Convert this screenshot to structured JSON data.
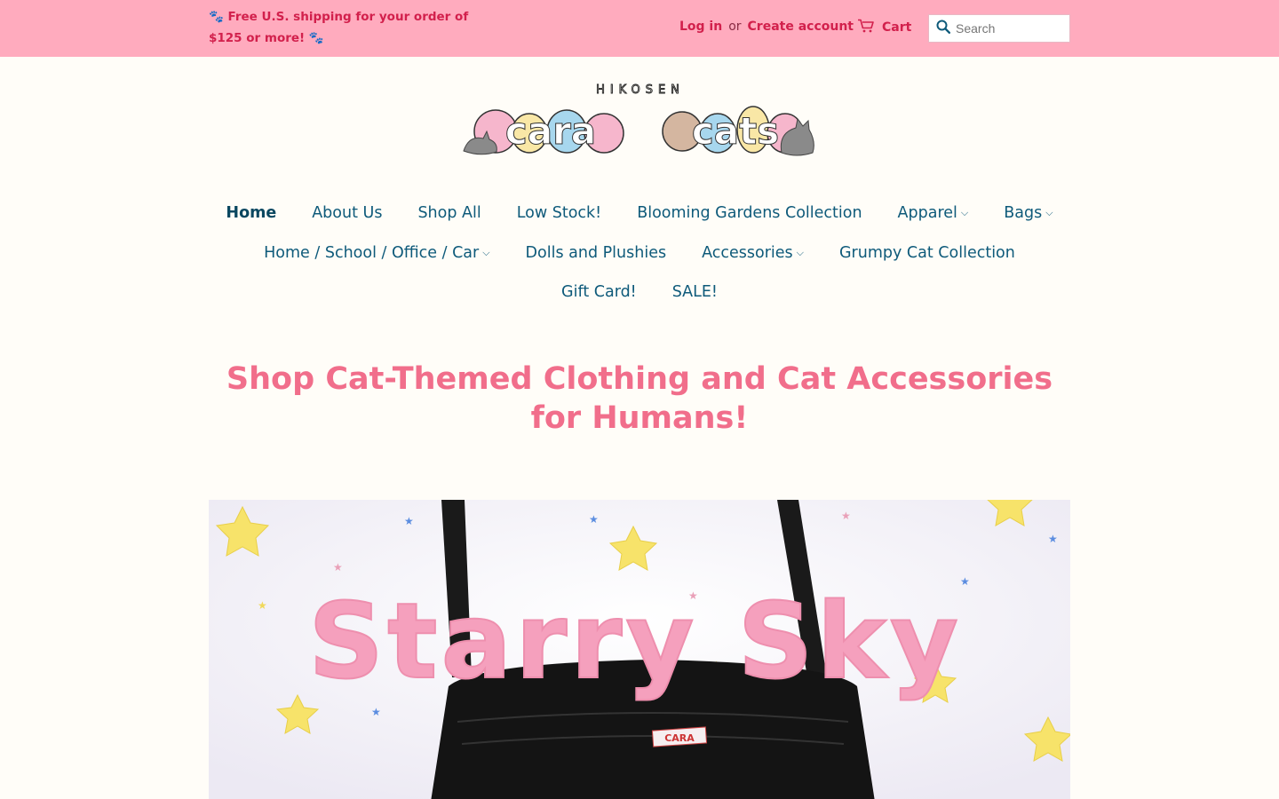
{
  "announcement": {
    "text": "🐾 Free U.S. shipping for your order of $125 or more! 🐾"
  },
  "account": {
    "login_label": "Log in",
    "or_label": "or",
    "create_label": "Create account"
  },
  "cart": {
    "label": "Cart"
  },
  "search": {
    "placeholder": "Search"
  },
  "logo": {
    "brand_top": "HIKOSEN",
    "word1": "cara",
    "word2": "cats"
  },
  "nav": {
    "row1": [
      {
        "label": "Home",
        "active": true
      },
      {
        "label": "About Us"
      },
      {
        "label": "Shop All"
      },
      {
        "label": "Low Stock!"
      },
      {
        "label": "Blooming Gardens Collection"
      },
      {
        "label": "Apparel",
        "dropdown": true
      },
      {
        "label": "Bags",
        "dropdown": true
      }
    ],
    "row2": [
      {
        "label": "Home / School / Office / Car",
        "dropdown": true
      },
      {
        "label": "Dolls and Plushies"
      },
      {
        "label": "Accessories",
        "dropdown": true
      },
      {
        "label": "Grumpy Cat Collection"
      }
    ],
    "row3": [
      {
        "label": "Gift Card!"
      },
      {
        "label": "SALE!"
      }
    ]
  },
  "page": {
    "headline": "Shop Cat-Themed Clothing and Cat Accessories for Humans!"
  },
  "hero": {
    "title": "Starry Sky",
    "tag_text": "CARA"
  },
  "colors": {
    "topbar_bg": "#ffabbe",
    "topbar_text": "#d2204c",
    "nav_text": "#0e5a7a",
    "headline": "#f16e8b",
    "page_bg": "#fffdf8"
  }
}
